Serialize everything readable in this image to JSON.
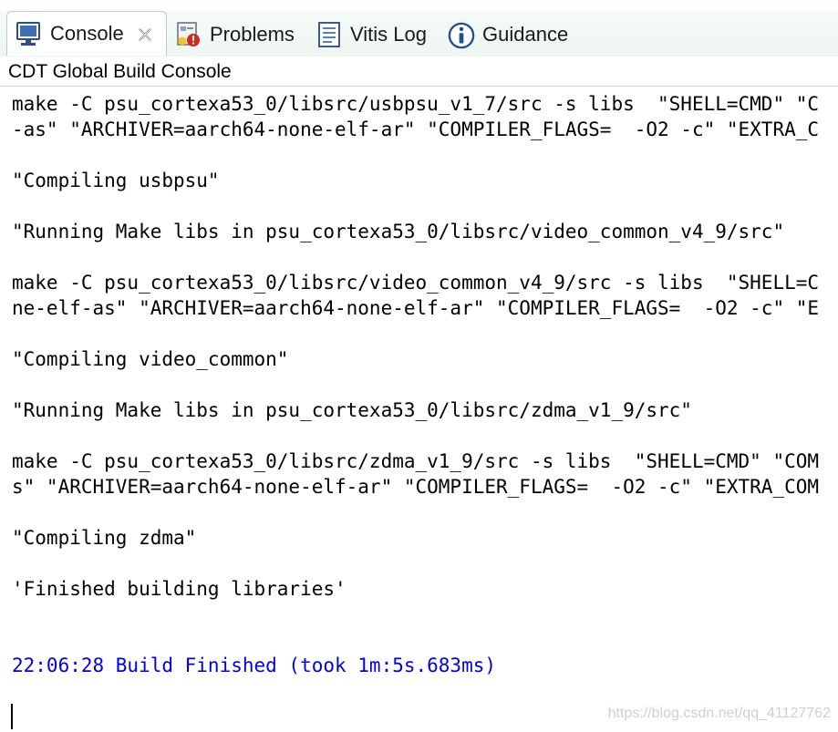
{
  "tabs": [
    {
      "label": "Console",
      "icon": "console-icon",
      "active": true,
      "close_icon": "close-icon"
    },
    {
      "label": "Problems",
      "icon": "problems-icon",
      "active": false
    },
    {
      "label": "Vitis Log",
      "icon": "log-icon",
      "active": false
    },
    {
      "label": "Guidance",
      "icon": "info-icon",
      "active": false
    }
  ],
  "console": {
    "title": "CDT Global Build Console",
    "lines": [
      "make -C psu_cortexa53_0/libsrc/usbpsu_v1_7/src -s libs  \"SHELL=CMD\" \"C",
      "-as\" \"ARCHIVER=aarch64-none-elf-ar\" \"COMPILER_FLAGS=  -O2 -c\" \"EXTRA_C",
      "",
      "\"Compiling usbpsu\"",
      "",
      "\"Running Make libs in psu_cortexa53_0/libsrc/video_common_v4_9/src\"",
      "",
      "make -C psu_cortexa53_0/libsrc/video_common_v4_9/src -s libs  \"SHELL=C",
      "ne-elf-as\" \"ARCHIVER=aarch64-none-elf-ar\" \"COMPILER_FLAGS=  -O2 -c\" \"E",
      "",
      "\"Compiling video_common\"",
      "",
      "\"Running Make libs in psu_cortexa53_0/libsrc/zdma_v1_9/src\"",
      "",
      "make -C psu_cortexa53_0/libsrc/zdma_v1_9/src -s libs  \"SHELL=CMD\" \"COM",
      "s\" \"ARCHIVER=aarch64-none-elf-ar\" \"COMPILER_FLAGS=  -O2 -c\" \"EXTRA_COM",
      "",
      "\"Compiling zdma\"",
      "",
      "'Finished building libraries'",
      "",
      "",
      "22:06:28 Build Finished (took 1m:5s.683ms)"
    ],
    "finished_color": "#0000e6",
    "text_color": "#000000"
  },
  "watermark": "https://blog.csdn.net/qq_41127762"
}
